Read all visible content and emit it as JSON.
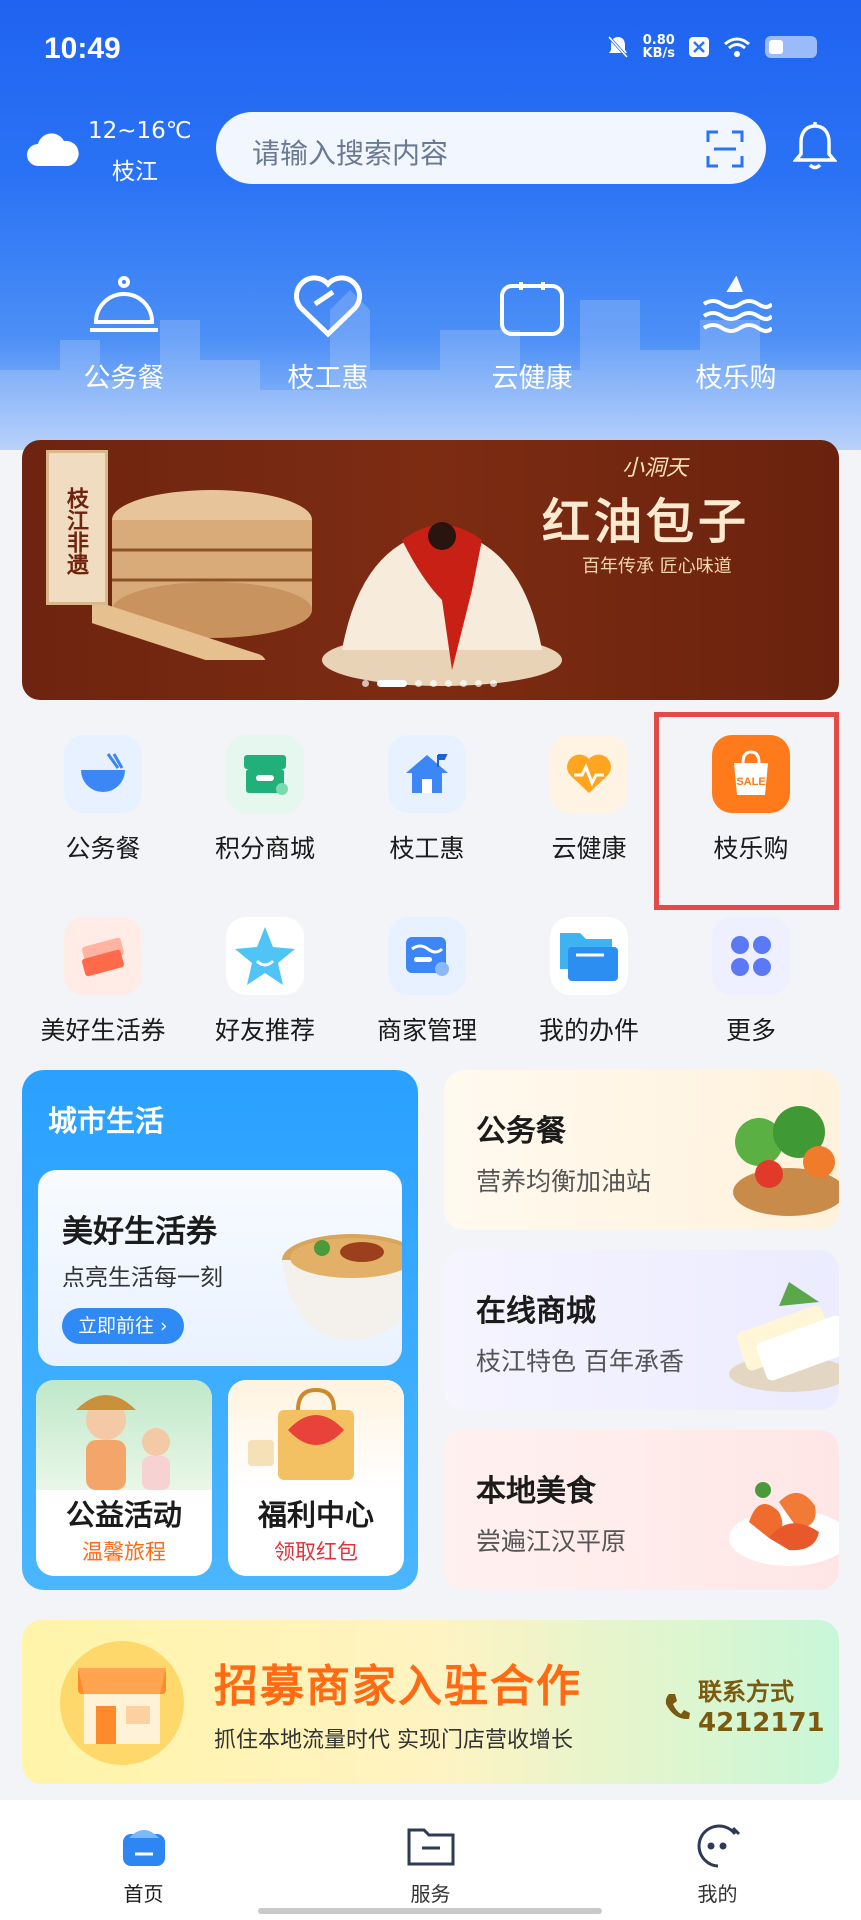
{
  "status_bar": {
    "time": "10:49",
    "net_speed": "0.80",
    "net_unit": "KB/s"
  },
  "weather": {
    "temp": "12~16℃",
    "city": "枝江"
  },
  "search": {
    "placeholder": "请输入搜索内容"
  },
  "top_nav": [
    {
      "label": "公务餐",
      "icon": "cloche-icon"
    },
    {
      "label": "枝工惠",
      "icon": "heart-icon"
    },
    {
      "label": "云健康",
      "icon": "square-icon"
    },
    {
      "label": "枝乐购",
      "icon": "wave-icon"
    }
  ],
  "banner": {
    "tag": "枝江非遗",
    "brand": "小洞天",
    "title": "红油包子",
    "subtitle": "百年传承 匠心味道"
  },
  "grid": [
    {
      "label": "公务餐",
      "icon": "bowl-icon",
      "color": "#e8f1ff"
    },
    {
      "label": "积分商城",
      "icon": "store-icon",
      "color": "#e6f7ef"
    },
    {
      "label": "枝工惠",
      "icon": "house-icon",
      "color": "#e8f1ff"
    },
    {
      "label": "云健康",
      "icon": "pulse-icon",
      "color": "#fff4e3"
    },
    {
      "label": "枝乐购",
      "icon": "sale-bag-icon",
      "color": "#ff7a1a"
    },
    {
      "label": "美好生活券",
      "icon": "ticket-icon",
      "color": "#ffece6"
    },
    {
      "label": "好友推荐",
      "icon": "star-icon",
      "color": "#ffffff"
    },
    {
      "label": "商家管理",
      "icon": "merchant-icon",
      "color": "#e8f1ff"
    },
    {
      "label": "我的办件",
      "icon": "folder-icon",
      "color": "#ffffff"
    },
    {
      "label": "更多",
      "icon": "grid-icon",
      "color": "#eef0ff"
    }
  ],
  "city_card": {
    "title": "城市生活",
    "life": {
      "title": "美好生活券",
      "subtitle": "点亮生活每一刻",
      "button": "立即前往"
    },
    "welfare": {
      "title": "公益活动",
      "subtitle": "温馨旅程"
    },
    "benefit": {
      "title": "福利中心",
      "subtitle": "领取红包"
    }
  },
  "side_cards": [
    {
      "title": "公务餐",
      "subtitle": "营养均衡加油站",
      "bg": "#fff7e8"
    },
    {
      "title": "在线商城",
      "subtitle": "枝江特色 百年承香",
      "bg": "#f1f1ff"
    },
    {
      "title": "本地美食",
      "subtitle": "尝遍江汉平原",
      "bg": "#ffeeee"
    }
  ],
  "recruit": {
    "title": "招募商家入驻合作",
    "subtitle": "抓住本地流量时代 实现门店营收增长",
    "contact_label": "联系方式",
    "contact_number": "4212171"
  },
  "tabbar": [
    {
      "label": "首页",
      "active": true
    },
    {
      "label": "服务",
      "active": false
    },
    {
      "label": "我的",
      "active": false
    }
  ]
}
